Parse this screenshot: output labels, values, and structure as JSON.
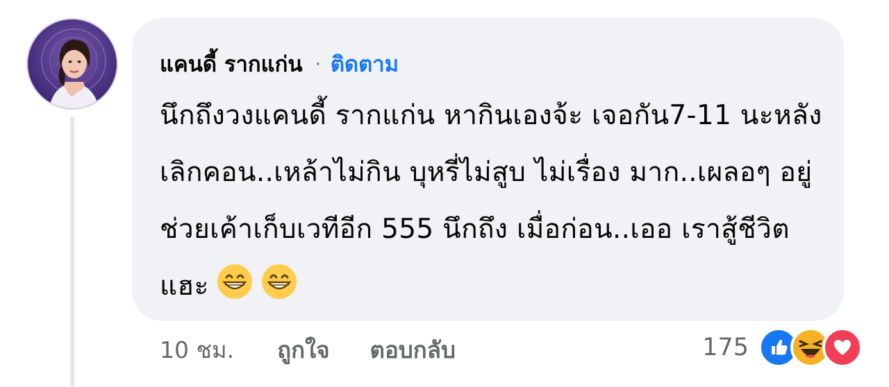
{
  "comment": {
    "author": "แคนดี้ รากแก่น",
    "separator": "·",
    "follow_label": "ติดตาม",
    "text": "นึกถึงวงแคนดี้ รากแก่น หากินเองจ้ะ เจอกัน7-11 นะหลังเลิกคอน..เหล้าไม่กิน บุหรี่ไม่สูบ ไม่เรื่อง มาก..เผลอๆ อยู่ช่วยเค้าเก็บเวทีอีก 555 นึกถึง เมื่อก่อน..เออ เราสู้ชีวิตแฮะ",
    "emojis": [
      "grinning-face-icon",
      "grinning-face-icon"
    ]
  },
  "actions": {
    "time": "10 ชม.",
    "like_label": "ถูกใจ",
    "reply_label": "ตอบกลับ"
  },
  "reactions": {
    "count": "175",
    "icons": [
      "like-icon",
      "haha-icon",
      "love-icon"
    ],
    "colors": {
      "like": "#1877f2",
      "haha": "#f7b125",
      "love": "#f33e58"
    }
  },
  "colors": {
    "bubble": "#f0f2f5",
    "link": "#1877f2",
    "secondary_text": "#65676b",
    "thread_line": "#e4e6eb"
  }
}
